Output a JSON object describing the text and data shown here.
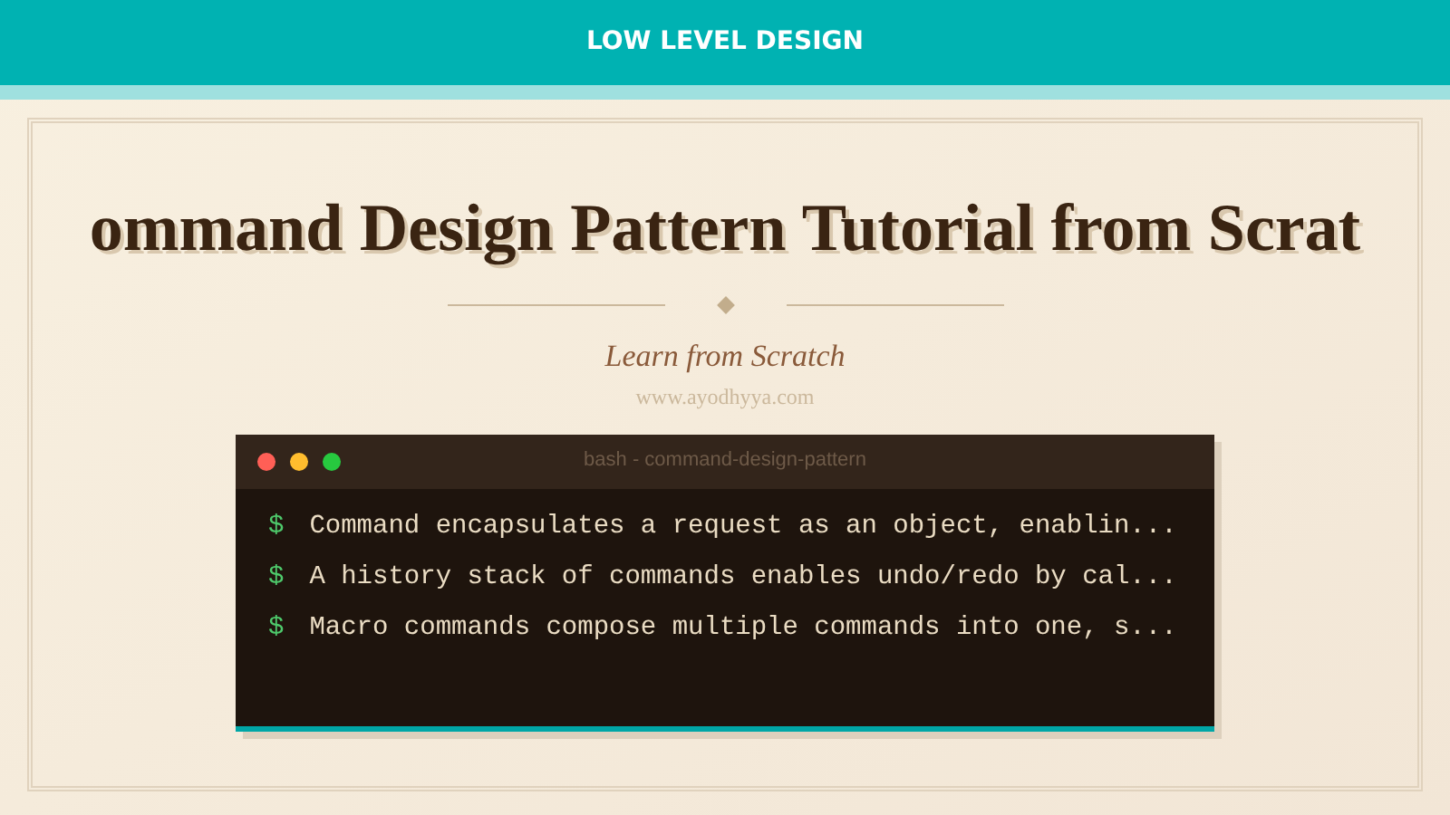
{
  "header": {
    "title": "LOW LEVEL DESIGN"
  },
  "title": "ommand Design Pattern Tutorial from Scrat",
  "subtitle": "Learn from Scratch",
  "website": "www.ayodhyya.com",
  "terminal": {
    "title": "bash - command-design-pattern",
    "lines": [
      {
        "prompt": "$",
        "text": "Command encapsulates a request as an object, enablin..."
      },
      {
        "prompt": "$",
        "text": "A history stack of commands enables undo/redo by cal..."
      },
      {
        "prompt": "$",
        "text": "Macro commands compose multiple commands into one, s..."
      }
    ]
  }
}
